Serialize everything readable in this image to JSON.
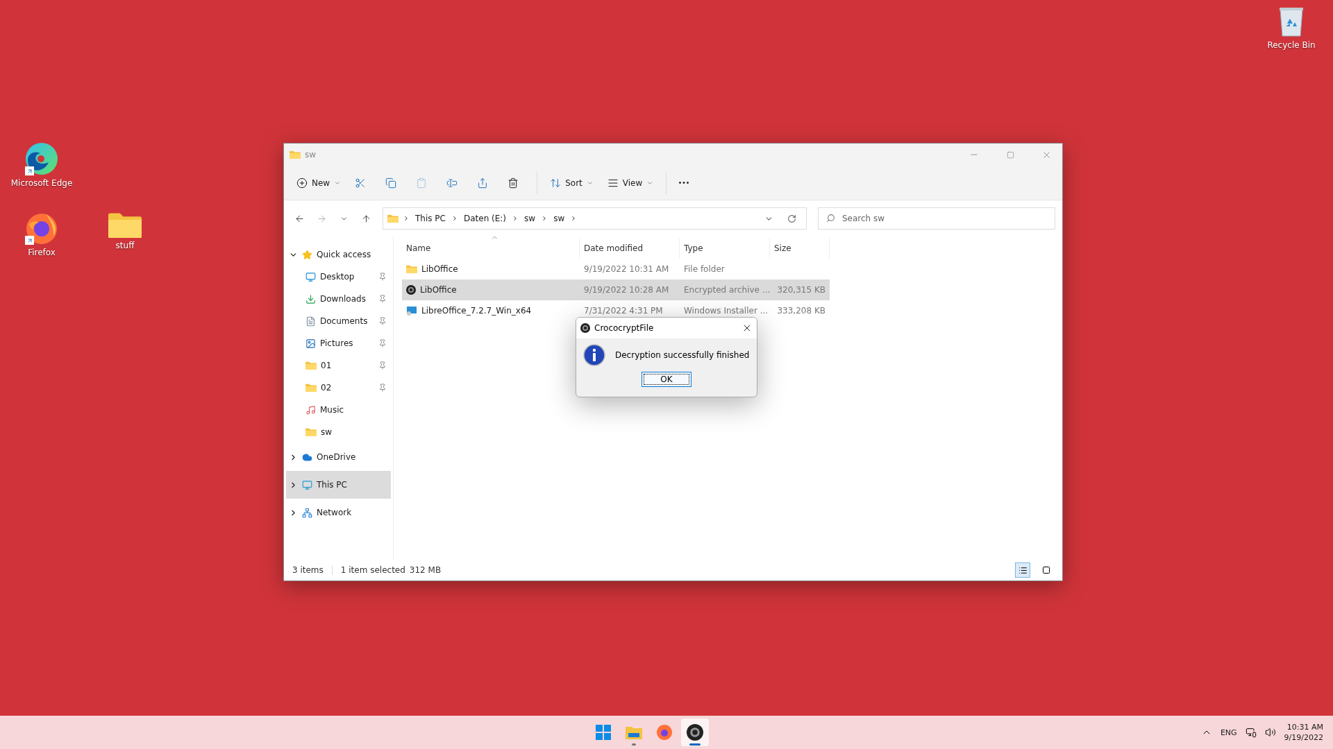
{
  "desktop": {
    "icons": [
      {
        "kind": "edge",
        "label": "Microsoft Edge",
        "shortcut": true
      },
      {
        "kind": "firefox",
        "label": "Firefox",
        "shortcut": true
      },
      {
        "kind": "folder",
        "label": "stuff",
        "shortcut": false
      },
      {
        "kind": "recycle-bin",
        "label": "Recycle Bin",
        "shortcut": false
      }
    ]
  },
  "window": {
    "title": "sw",
    "toolbar": [
      {
        "kind": "new",
        "label": "New",
        "dropdown": true
      },
      {
        "kind": "cut"
      },
      {
        "kind": "copy"
      },
      {
        "kind": "paste",
        "disabled": true
      },
      {
        "kind": "rename"
      },
      {
        "kind": "share"
      },
      {
        "kind": "delete"
      },
      {
        "kind": "separator"
      },
      {
        "kind": "sort",
        "label": "Sort",
        "dropdown": true
      },
      {
        "kind": "view",
        "label": "View",
        "dropdown": true
      },
      {
        "kind": "separator"
      },
      {
        "kind": "more"
      }
    ],
    "nav": {
      "forward_disabled": true
    },
    "breadcrumb": [
      "This PC",
      "Daten (E:)",
      "sw",
      "sw"
    ],
    "search": {
      "placeholder": "Search sw"
    },
    "sidebar": [
      {
        "kind": "star",
        "label": "Quick access",
        "expanded": true,
        "selected": false,
        "children": [
          {
            "kind": "desktop",
            "label": "Desktop",
            "pinned": true,
            "selected": false
          },
          {
            "kind": "downloads",
            "label": "Downloads",
            "pinned": true,
            "selected": false
          },
          {
            "kind": "documents",
            "label": "Documents",
            "pinned": true,
            "selected": false
          },
          {
            "kind": "pictures",
            "label": "Pictures",
            "pinned": true,
            "selected": false
          },
          {
            "kind": "folder",
            "label": "01",
            "pinned": true,
            "selected": false
          },
          {
            "kind": "folder",
            "label": "02",
            "pinned": true,
            "selected": false
          },
          {
            "kind": "music",
            "label": "Music",
            "pinned": false,
            "selected": false
          },
          {
            "kind": "folder",
            "label": "sw",
            "pinned": false,
            "selected": false
          }
        ]
      },
      {
        "kind": "cloud",
        "label": "OneDrive",
        "expanded": false,
        "selected": false
      },
      {
        "kind": "pc",
        "label": "This PC",
        "expanded": false,
        "selected": true
      },
      {
        "kind": "network",
        "label": "Network",
        "expanded": false,
        "selected": false
      }
    ],
    "columns": [
      {
        "label": "Name",
        "sorted": true
      },
      {
        "label": "Date modified",
        "sorted": false
      },
      {
        "label": "Type",
        "sorted": false
      },
      {
        "label": "Size",
        "sorted": false
      }
    ],
    "rows": [
      {
        "kind": "folder",
        "name": "LibOffice",
        "date": "9/19/2022 10:31 AM",
        "type": "File folder",
        "selected": false
      },
      {
        "kind": "archive",
        "name": "LibOffice",
        "date": "9/19/2022 10:28 AM",
        "type": "Encrypted archive ...",
        "size": "320,315 KB",
        "selected": true
      },
      {
        "kind": "installer",
        "name": "LibreOffice_7.2.7_Win_x64",
        "date": "7/31/2022 4:31 PM",
        "type": "Windows Installer ...",
        "size": "333,208 KB",
        "selected": false
      }
    ],
    "status_bar": {
      "count": "3 items",
      "selection": "1 item selected",
      "size": "312 MB",
      "views": [
        {
          "kind": "details",
          "selected": true
        },
        {
          "kind": "tiles",
          "selected": false
        }
      ]
    }
  },
  "dialog": {
    "title": "CrococryptFile",
    "message": "Decryption successfully finished",
    "button": "OK"
  },
  "taskbar": {
    "apps": [
      {
        "kind": "start",
        "running": false,
        "active": false
      },
      {
        "kind": "explorer",
        "running": true,
        "active": false
      },
      {
        "kind": "firefox",
        "running": false,
        "active": false
      },
      {
        "kind": "crococrypt",
        "running": true,
        "active": true
      }
    ],
    "language": "ENG",
    "time": "10:31 AM",
    "date": "9/19/2022"
  }
}
